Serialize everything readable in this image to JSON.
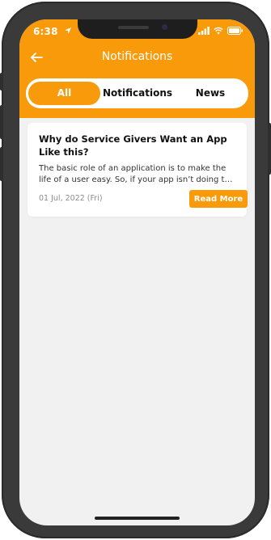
{
  "status_bar": {
    "time": "6:38"
  },
  "header": {
    "title": "Notifications"
  },
  "tabs": [
    {
      "label": "All",
      "active": true
    },
    {
      "label": "Notifications",
      "active": false
    },
    {
      "label": "News",
      "active": false
    }
  ],
  "cards": [
    {
      "title": "Why do Service Givers Want an App Like this?",
      "body_line1": "The basic role of an application is to make the",
      "body_line2": "life of a user easy. So, if your app isn’t doing that...",
      "date": "01 Jul, 2022 (Fri)",
      "button_label": "Read More"
    }
  ],
  "colors": {
    "accent": "#f89a0a",
    "background": "#f1f1f1",
    "card": "#ffffff"
  },
  "icons": {
    "back": "arrow-left",
    "location": "navigation-arrow",
    "signal": "cellular-signal",
    "wifi": "wifi",
    "battery": "battery"
  }
}
